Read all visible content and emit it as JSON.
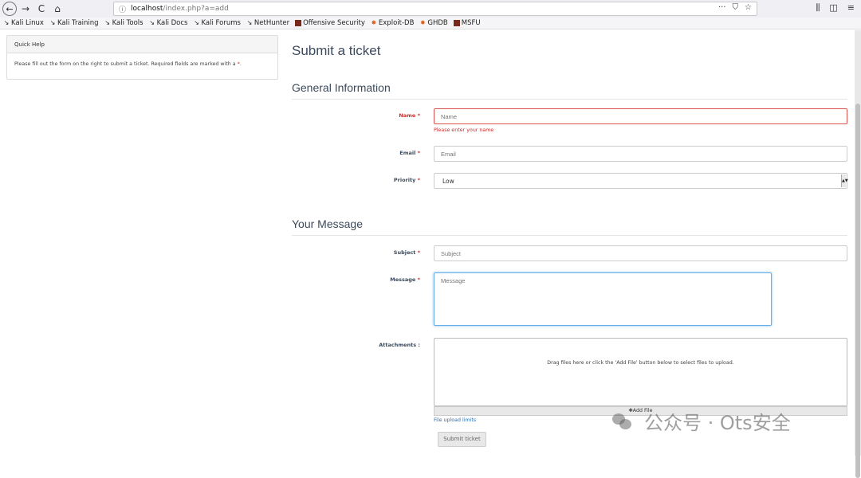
{
  "browser": {
    "url_host": "localhost",
    "url_path": "/index.php?a=add",
    "bookmarks": [
      "Kali Linux",
      "Kali Training",
      "Kali Tools",
      "Kali Docs",
      "Kali Forums",
      "NetHunter",
      "Offensive Security",
      "Exploit-DB",
      "GHDB",
      "MSFU"
    ]
  },
  "help": {
    "title": "Quick Help",
    "text": "Please fill out the form on the right to submit a ticket. Required fields are marked with a",
    "marker": "*."
  },
  "form": {
    "title": "Submit a ticket",
    "general_section": "General Information",
    "name_label": "Name",
    "name_placeholder": "Name",
    "name_error": "Please enter your name",
    "email_label": "Email",
    "email_placeholder": "Email",
    "priority_label": "Priority",
    "priority_value": "Low",
    "message_section": "Your Message",
    "subject_label": "Subject",
    "subject_placeholder": "Subject",
    "message_label": "Message",
    "message_placeholder": "Message",
    "attachments_label": "Attachments :",
    "dropzone_text": "Drag files here or click the 'Add File' button below to select files to upload.",
    "add_file": "Add File",
    "upload_limits": "File upload limits",
    "submit": "Submit ticket",
    "required_marker": "*"
  },
  "watermark": "公众号 · Ots安全"
}
